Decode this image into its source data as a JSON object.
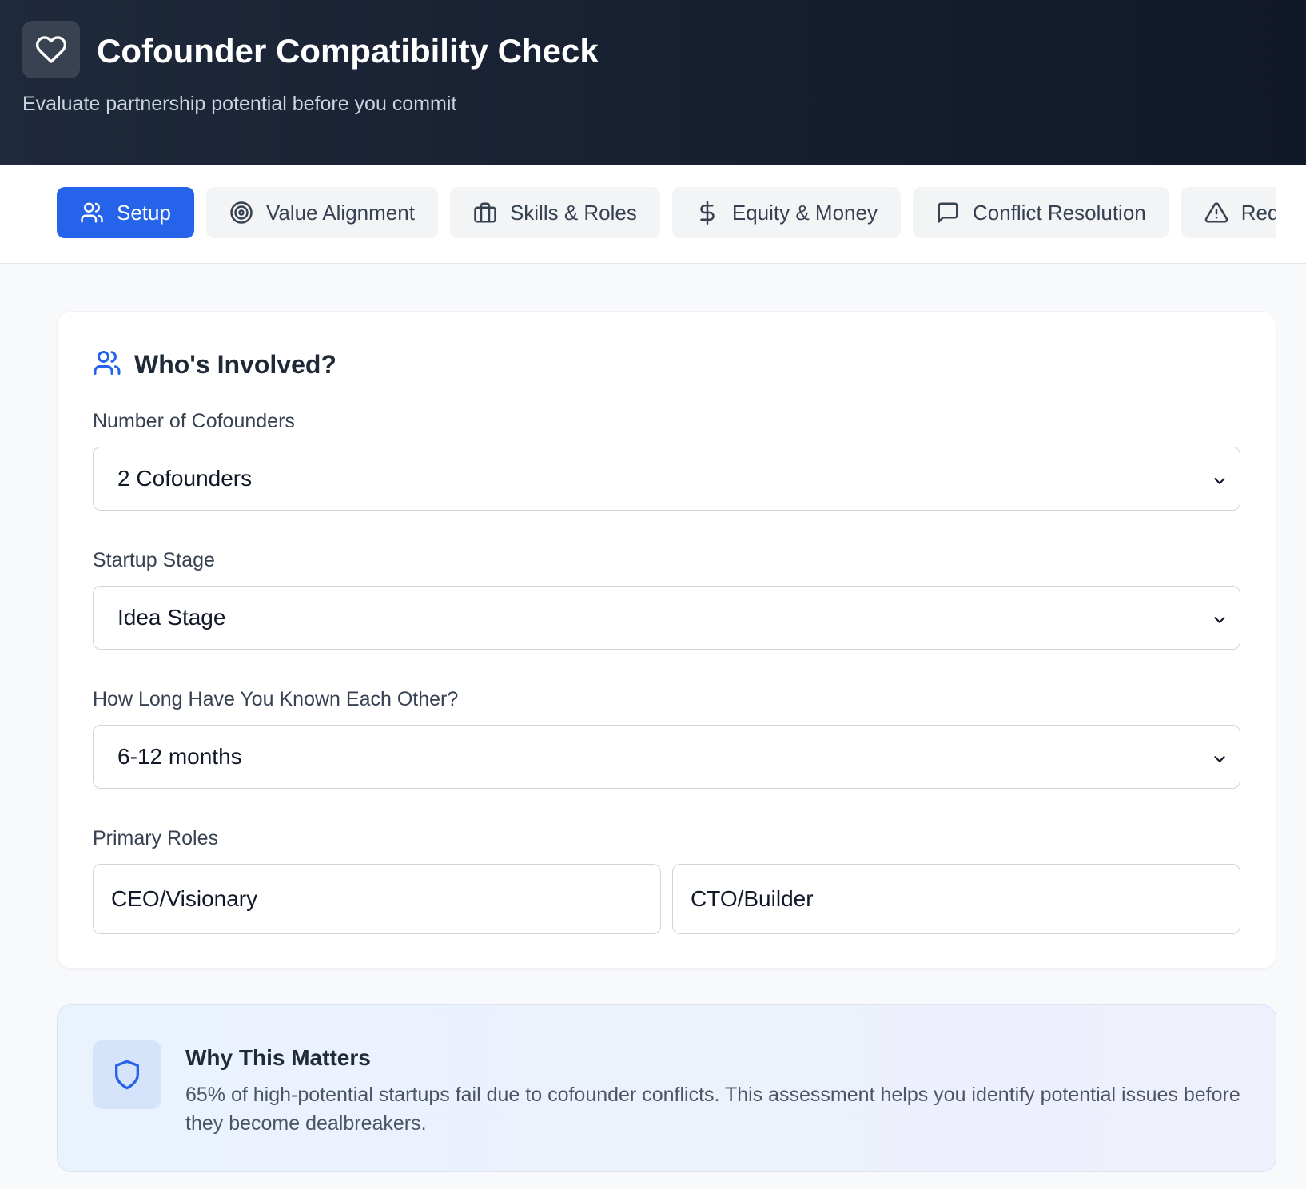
{
  "header": {
    "title": "Cofounder Compatibility Check",
    "subtitle": "Evaluate partnership potential before you commit",
    "logo_icon": "heart-icon"
  },
  "tabs": [
    {
      "label": "Setup",
      "icon": "users-icon",
      "active": true
    },
    {
      "label": "Value Alignment",
      "icon": "target-icon",
      "active": false
    },
    {
      "label": "Skills & Roles",
      "icon": "briefcase-icon",
      "active": false
    },
    {
      "label": "Equity & Money",
      "icon": "dollar-icon",
      "active": false
    },
    {
      "label": "Conflict Resolution",
      "icon": "message-icon",
      "active": false
    },
    {
      "label": "Red",
      "icon": "alert-triangle-icon",
      "active": false
    }
  ],
  "setup_card": {
    "title": "Who's Involved?",
    "cofounders": {
      "label": "Number of Cofounders",
      "value": "2 Cofounders"
    },
    "stage": {
      "label": "Startup Stage",
      "value": "Idea Stage"
    },
    "known": {
      "label": "How Long Have You Known Each Other?",
      "value": "6-12 months"
    },
    "roles": {
      "label": "Primary Roles",
      "role_1": "CEO/Visionary",
      "role_2": "CTO/Builder"
    }
  },
  "info": {
    "title": "Why This Matters",
    "text": "65% of high-potential startups fail due to cofounder conflicts. This assessment helps you identify potential issues before they become dealbreakers."
  },
  "colors": {
    "accent": "#2563eb",
    "header_bg": "#1e293b",
    "page_bg": "#f8f9fb"
  }
}
